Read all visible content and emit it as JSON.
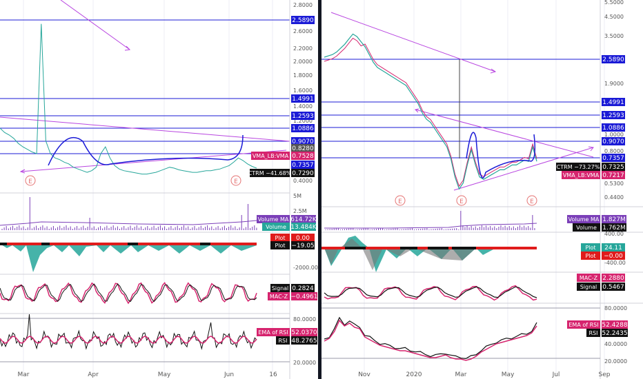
{
  "colors": {
    "hline": "#1a1ad6",
    "trend": "#b845e0",
    "volma": "#7b3fb8",
    "vol": "#26a69a",
    "plot_black": "#111111",
    "plot_red": "#e01b1b",
    "macz_red": "#d6246e",
    "signal_black": "#111111",
    "ema_rsi": "#d6246e",
    "ctrm": "#111111",
    "vma": "#d6246e",
    "text_dark": "#555555"
  },
  "levels": [
    "2.5890",
    "1.4991",
    "1.2593",
    "1.0886",
    "0.9070",
    "0.7357"
  ],
  "left": {
    "price_axis": [
      "2.8000",
      "2.6000",
      "2.4000",
      "2.2000",
      "2.0000",
      "1.8000",
      "1.6000",
      "1.4000",
      "1.2000",
      "0.6000",
      "0.4000"
    ],
    "price_labels": {
      "l1": "2.5890",
      "l2": "1.4991",
      "l3": "1.2593",
      "l4": "1.0886",
      "l5": "0.9070",
      "p1": "0.8280",
      "p2": "0.7528",
      "p3": "0.7357",
      "p4": "0.7290",
      "vma_text": "VMA_LB:VMA",
      "ctrm_text": "CTRM −41.68%"
    },
    "events": [
      "E",
      "E"
    ],
    "volume": {
      "axis": [
        "5M",
        "2.5M"
      ],
      "ma_label": "Volume MA",
      "ma_value": "614.72K",
      "vol_label": "Volume",
      "vol_value": "13.484K"
    },
    "osc": {
      "axis": [
        "-2000.00"
      ],
      "plot1_label": "Plot",
      "plot1_value": "0.00",
      "plot2_label": "Plot",
      "plot2_value": "−19.05"
    },
    "macz": {
      "sig_label": "Signal",
      "sig_value": "0.2824",
      "mz_label": "MAC-Z",
      "mz_value": "−0.4961"
    },
    "rsi": {
      "axis": [
        "80.0000",
        "20.0000"
      ],
      "ema_label": "EMA of RSI",
      "ema_value": "52.0370",
      "rsi_label": "RSI",
      "rsi_value": "48.2765"
    },
    "time_axis": [
      "Mar",
      "Apr",
      "May",
      "Jun",
      "16"
    ]
  },
  "right": {
    "price_axis": [
      "5.5000",
      "4.5000",
      "3.5000",
      "1.9000",
      "1.0000",
      "0.8000",
      "0.5300",
      "0.4400"
    ],
    "price_labels": {
      "l1": "2.5890",
      "l2": "1.4991",
      "l3": "1.2593",
      "l4": "1.0886",
      "l5": "0.9070",
      "l6": "0.7357",
      "ctrm_text": "CTRM −73.27%",
      "ctrm_value": "0.7325",
      "vma_text": "VMA_LB:VMA",
      "vma_value": "0.7217"
    },
    "events": [
      "E",
      "E",
      "E"
    ],
    "volume": {
      "ma_label": "Volume MA",
      "ma_value": "1.827M",
      "vol_label": "Volume",
      "vol_value": "1.762M"
    },
    "osc": {
      "axis": [
        "400.00",
        "-400.00"
      ],
      "plot1_label": "Plot",
      "plot1_value": "24.11",
      "plot2_label": "Plot",
      "plot2_value": "−0.00"
    },
    "macz": {
      "mz_label": "MAC-Z",
      "mz_value": "2.2880",
      "sig_label": "Signal",
      "sig_value": "0.5467"
    },
    "rsi": {
      "axis": [
        "80.0000",
        "40.0000",
        "20.0000"
      ],
      "ema_label": "EMA of RSI",
      "ema_value": "52.4288",
      "rsi_label": "RSI",
      "rsi_value": "52.2435"
    },
    "time_axis": [
      "Nov",
      "2020",
      "Mar",
      "May",
      "Jul",
      "Sep"
    ]
  },
  "chart_data": [
    {
      "type": "line",
      "panel": "left-price",
      "x_ticks": [
        "Mar",
        "Apr",
        "May",
        "Jun",
        "16"
      ],
      "y_ticks": [
        2.8,
        2.6,
        2.4,
        2.2,
        2.0,
        1.8,
        1.6,
        1.4,
        1.2,
        0.6,
        0.4
      ],
      "horizontal_levels": [
        2.589,
        1.4991,
        1.2593,
        1.0886,
        0.907,
        0.7357
      ],
      "price_series": [
        1.2,
        1.15,
        1.12,
        1.08,
        1.02,
        0.98,
        0.95,
        0.92,
        0.9,
        2.55,
        1.05,
        0.9,
        0.85,
        0.83,
        0.8,
        0.78,
        0.74,
        0.72,
        0.7,
        0.68,
        0.7,
        0.74,
        0.9,
        0.98,
        0.85,
        0.76,
        0.72,
        0.7,
        0.69,
        0.68,
        0.67,
        0.66,
        0.66,
        0.67,
        0.68,
        0.7,
        0.72,
        0.74,
        0.73,
        0.71,
        0.7,
        0.69,
        0.68,
        0.68,
        0.69,
        0.7,
        0.7,
        0.71,
        0.72,
        0.74,
        0.76,
        0.8,
        0.85,
        0.82,
        0.78,
        0.75,
        0.73
      ]
    },
    {
      "type": "line",
      "panel": "right-price",
      "x_ticks": [
        "Nov",
        "2020",
        "Mar",
        "May",
        "Jul",
        "Sep"
      ],
      "y_ticks": [
        5.5,
        4.5,
        3.5,
        1.9,
        1.0,
        0.8,
        0.53,
        0.44
      ],
      "horizontal_levels": [
        2.589,
        1.4991,
        1.2593,
        1.0886,
        0.907,
        0.7357
      ],
      "price_series": [
        3.0,
        3.05,
        3.1,
        3.2,
        3.35,
        3.5,
        3.7,
        3.9,
        3.8,
        3.6,
        3.4,
        3.1,
        2.8,
        2.6,
        2.5,
        2.4,
        2.3,
        2.2,
        2.1,
        2.0,
        1.9,
        1.8,
        1.7,
        1.6,
        1.45,
        1.35,
        1.3,
        1.2,
        1.1,
        1.0,
        0.9,
        0.75,
        0.6,
        0.5,
        0.55,
        0.7,
        0.85,
        0.7,
        0.6,
        0.58,
        0.6,
        0.62,
        0.64,
        0.66,
        0.66,
        0.68,
        0.7,
        0.7,
        0.72,
        0.74,
        0.73,
        0.9,
        0.73
      ]
    },
    {
      "type": "bar",
      "panel": "volume",
      "series": [
        {
          "name": "Volume MA",
          "values": []
        },
        {
          "name": "Volume",
          "values": []
        }
      ]
    },
    {
      "type": "line",
      "panel": "rsi",
      "y_ticks": [
        80,
        40,
        20
      ],
      "series": [
        {
          "name": "EMA of RSI",
          "values": []
        },
        {
          "name": "RSI",
          "values": []
        }
      ]
    }
  ]
}
